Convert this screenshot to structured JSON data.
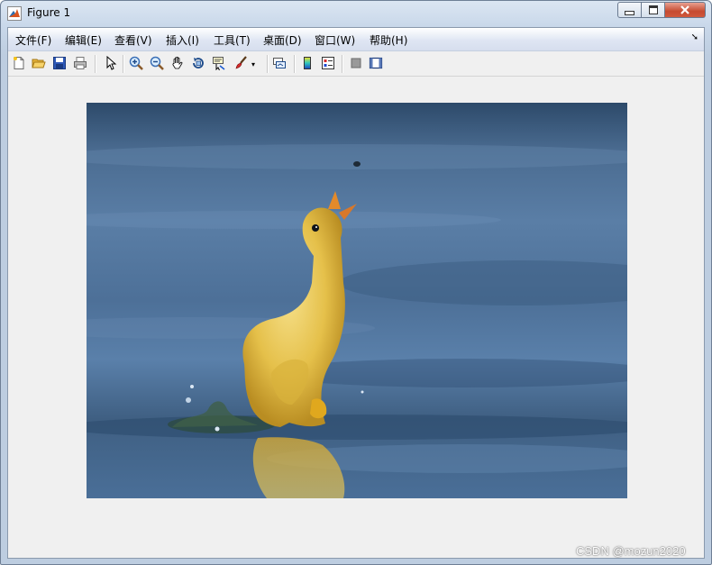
{
  "window": {
    "title": "Figure 1"
  },
  "menu": {
    "items": [
      {
        "label": "文件(F)"
      },
      {
        "label": "编辑(E)"
      },
      {
        "label": "查看(V)"
      },
      {
        "label": "插入(I)"
      },
      {
        "label": "工具(T)"
      },
      {
        "label": "桌面(D)"
      },
      {
        "label": "窗口(W)"
      },
      {
        "label": "帮助(H)"
      }
    ]
  },
  "toolbar": {
    "buttons": [
      {
        "icon": "new-figure-icon"
      },
      {
        "icon": "open-file-icon"
      },
      {
        "icon": "save-icon"
      },
      {
        "icon": "print-icon"
      },
      {
        "icon": "edit-plot-arrow-icon"
      },
      {
        "icon": "zoom-in-icon"
      },
      {
        "icon": "zoom-out-icon"
      },
      {
        "icon": "pan-hand-icon"
      },
      {
        "icon": "rotate-3d-icon"
      },
      {
        "icon": "data-cursor-icon"
      },
      {
        "icon": "brush-icon"
      },
      {
        "icon": "link-plot-icon"
      },
      {
        "icon": "colorbar-icon"
      },
      {
        "icon": "legend-icon"
      },
      {
        "icon": "hide-plot-tools-icon"
      },
      {
        "icon": "show-plot-tools-icon"
      }
    ]
  },
  "figure": {
    "image_description_icon": "duckling-photo-image"
  },
  "watermark": "CSDN @mozun2020",
  "colors": {
    "close_button": "#c64a30",
    "water_dark": "#34506f",
    "water_mid": "#4c6d91",
    "duckling": "#e7c44a"
  }
}
